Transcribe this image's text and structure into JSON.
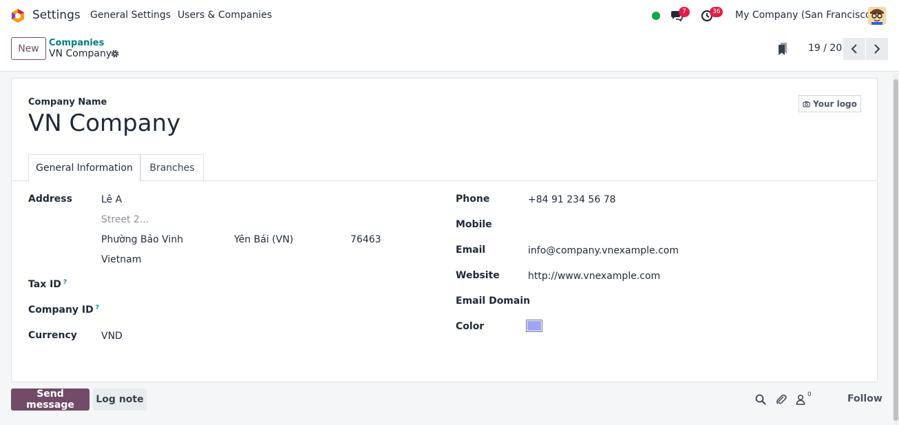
{
  "topbar": {
    "app_name": "Settings",
    "menu": [
      "General Settings",
      "Users & Companies"
    ],
    "messages_badge": "7",
    "activities_badge": "36",
    "company_switcher": "My Company (San Francisco)"
  },
  "control": {
    "new_label": "New",
    "breadcrumb_parent": "Companies",
    "breadcrumb_current": "VN Company",
    "pager": "19 / 20"
  },
  "form": {
    "company_name_label": "Company Name",
    "company_name": "VN Company",
    "logo_label": "Your logo",
    "tabs": [
      "General Information",
      "Branches"
    ],
    "left": {
      "address_label": "Address",
      "street": "Lê A",
      "street2_placeholder": "Street 2...",
      "city": "Phường Bảo Vinh",
      "state": "Yên Bái (VN)",
      "zip": "76463",
      "country": "Vietnam",
      "tax_id_label": "Tax ID",
      "company_id_label": "Company ID",
      "help_mark": "?",
      "currency_label": "Currency",
      "currency": "VND"
    },
    "right": {
      "phone_label": "Phone",
      "phone": "+84 91 234 56 78",
      "mobile_label": "Mobile",
      "email_label": "Email",
      "email": "info@company.vnexample.com",
      "website_label": "Website",
      "website": "http://www.vnexample.com",
      "email_domain_label": "Email Domain",
      "color_label": "Color",
      "color_value": "#9ea5f5"
    }
  },
  "chatter": {
    "send_message": "Send message",
    "log_note": "Log note",
    "followers_count": "0",
    "follow": "Follow"
  }
}
